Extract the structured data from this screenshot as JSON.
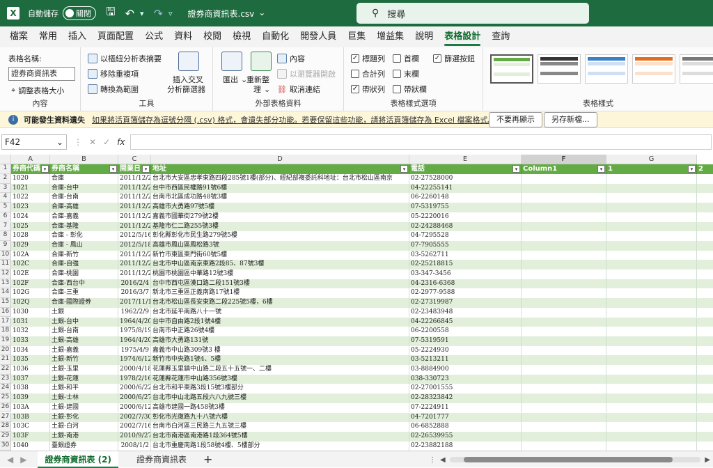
{
  "title_bar": {
    "app_icon": "X",
    "autosave_label": "自動儲存",
    "toggle_label": "關閉",
    "filename": "證券商資訊表.csv",
    "search_placeholder": "搜尋"
  },
  "menu": [
    "檔案",
    "常用",
    "插入",
    "頁面配置",
    "公式",
    "資料",
    "校閱",
    "檢視",
    "自動化",
    "開發人員",
    "巨集",
    "增益集",
    "說明",
    "表格設計",
    "查詢"
  ],
  "ribbon": {
    "props": {
      "table_name_label": "表格名稱:",
      "table_name_value": "證券商資訊表",
      "resize": "調整表格大小",
      "group": "內容"
    },
    "tools": {
      "pivot": "以樞紐分析表摘要",
      "dedupe": "移除重複項",
      "convert": "轉換為範圍",
      "slicer_line1": "插入交叉",
      "slicer_line2": "分析篩選器",
      "group": "工具"
    },
    "external": {
      "export": "匯出",
      "refresh": "重新整",
      "refresh2": "理",
      "props": "內容",
      "browser": "以瀏覽器開啟",
      "unlink": "取消連結",
      "group": "外部表格資料"
    },
    "style_opts": {
      "header_row": "標題列",
      "first_col": "首欄",
      "filter_btn": "篩選按鈕",
      "total_row": "合計列",
      "last_col": "末欄",
      "banded_rows": "帶狀列",
      "banded_cols": "帶狀欄",
      "group": "表格樣式選項"
    },
    "styles": {
      "group": "表格樣式"
    }
  },
  "message_bar": {
    "title": "可能發生資料遺失",
    "text": "如果將活頁簿儲存為逗號分隔 (.csv) 格式，會遺失部分功能。若要保留這些功能，請將活頁簿儲存為 Excel 檔案格式。",
    "btn_dismiss": "不要再顯示",
    "btn_saveas": "另存新檔..."
  },
  "formula_bar": {
    "name_box": "F42",
    "fx": "fx"
  },
  "columns": [
    "A",
    "B",
    "C",
    "D",
    "E",
    "F",
    "G"
  ],
  "headers": [
    "券商代碼",
    "券商名稱",
    "開業日",
    "地址",
    "電話",
    "Column1",
    "1",
    "2"
  ],
  "rows": [
    [
      "1020",
      "合庫",
      "2011/12/2",
      "台北市大安區忠孝東路四段285號1樓(部分)、經紀部複委託科地址：台北市松山區南京",
      "02-27528000"
    ],
    [
      "1021",
      "合庫-台中",
      "2011/12/2",
      "台中市西區民權路91號6樓",
      "04-22255141"
    ],
    [
      "1022",
      "合庫-台南",
      "2011/12/2",
      "台南市北區成功路48號3樓",
      "06-2260148"
    ],
    [
      "1023",
      "合庫-高雄",
      "2011/12/2",
      "高雄市大勇路97號5樓",
      "07-5319755"
    ],
    [
      "1024",
      "合庫-嘉義",
      "2011/12/2",
      "嘉義市國華街279號2樓",
      "05-2220016"
    ],
    [
      "1025",
      "合庫-基隆",
      "2011/12/2",
      "基隆市仁二路255號3樓",
      "02-24288468"
    ],
    [
      "1028",
      "合庫 - 彰化",
      "2012/5/16",
      "彰化縣彰化市民生路279號5樓",
      "04-7295528"
    ],
    [
      "1029",
      "合庫 - 鳳山",
      "2012/5/18",
      "高雄市鳳山區鳳松路3號",
      "07-7905555"
    ],
    [
      "102A",
      "合庫-新竹",
      "2011/12/2",
      "新竹市東區東門街60號5樓",
      "03-5262711"
    ],
    [
      "102C",
      "合庫-自強",
      "2011/12/2",
      "台北市中山區南京東路2段85、87號3樓",
      "02-25218815"
    ],
    [
      "102E",
      "合庫-桃園",
      "2011/12/2",
      "桃園市桃園區中華路12號3樓",
      "03-347-3456"
    ],
    [
      "102F",
      "合庫-西台中",
      "2016/2/4",
      "台中市西屯區漢口路二段151號3樓",
      "04-2316-6368"
    ],
    [
      "102G",
      "合庫-三重",
      "2016/3/7",
      "新北市三重區正義南路17號1樓",
      "02-2977-9588"
    ],
    [
      "102Q",
      "合庫-國際證券",
      "2017/11/1",
      "台北市松山區長安東路二段225號5樓，6樓",
      "02-27319987"
    ],
    [
      "1030",
      "土銀",
      "1962/2/9",
      "台北市延平南路八十一號",
      "02-23483948"
    ],
    [
      "1031",
      "土銀-台中",
      "1964/4/20",
      "台中市自由路2段1號4樓",
      "04-22266845"
    ],
    [
      "1032",
      "土銀-台南",
      "1975/8/19",
      "台南市中正路26號4樓",
      "06-2200558"
    ],
    [
      "1033",
      "土銀-高雄",
      "1964/4/20",
      "高雄市大勇路131號",
      "07-5319591"
    ],
    [
      "1034",
      "土銀-嘉義",
      "1975/4/9",
      "嘉義市中山路309號3 樓",
      "05-2224930"
    ],
    [
      "1035",
      "土銀-新竹",
      "1974/6/12",
      "新竹市中央路1號4、5樓",
      "03-5213211"
    ],
    [
      "1036",
      "土銀-玉里",
      "2000/4/18",
      "花蓮縣玉里鎮中山路二段五十五號一、二樓",
      "03-8884900"
    ],
    [
      "1037",
      "土銀-花蓮",
      "1978/2/16",
      "花蓮縣花蓮市中山路356號3樓",
      "038-330723"
    ],
    [
      "1038",
      "土銀-和平",
      "2000/6/22",
      "台北市和平東路3段15號3樓部分",
      "02-27001555"
    ],
    [
      "1039",
      "土銀-士林",
      "2000/6/27",
      "台北市中山北路五段六八九號三樓",
      "02-28323842"
    ],
    [
      "103A",
      "土銀-建國",
      "2000/6/12",
      "高雄市建國一路458號3樓",
      "07-2224911"
    ],
    [
      "103B",
      "土銀-彰化",
      "2002/7/30",
      "彰化市光復路九十八號六樓",
      "04-7201777"
    ],
    [
      "103C",
      "土銀-白河",
      "2002/7/16",
      "台南市白河區三民路三九五號三樓",
      "06-6852888"
    ],
    [
      "103F",
      "土銀-南港",
      "2010/9/27",
      "台北市南港區南港路1段364號5樓",
      "02-26539955"
    ],
    [
      "1040",
      "臺銀證券",
      "2008/1/2",
      "台北市重慶南路1段58號4樓、5樓部分",
      "02-23882188"
    ]
  ],
  "sheets": {
    "active": "證券商資訊表 (2)",
    "other": "證券商資訊表",
    "add": "+"
  },
  "styles_colors": {
    "green": "#63ab44",
    "band": "#e2efda"
  }
}
